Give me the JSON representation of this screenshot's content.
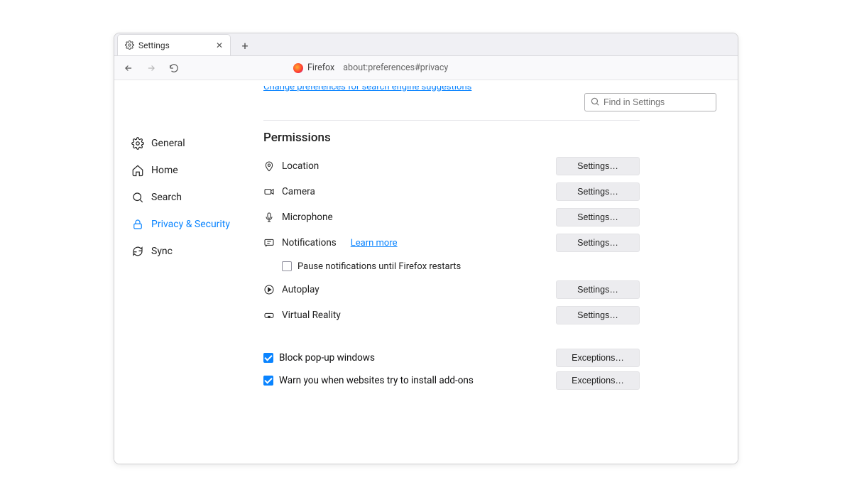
{
  "tab": {
    "title": "Settings"
  },
  "urlbar": {
    "product": "Firefox",
    "url": "about:preferences#privacy"
  },
  "search": {
    "placeholder": "Find in Settings"
  },
  "sidebar": {
    "items": [
      {
        "label": "General"
      },
      {
        "label": "Home"
      },
      {
        "label": "Search"
      },
      {
        "label": "Privacy & Security"
      },
      {
        "label": "Sync"
      }
    ]
  },
  "main": {
    "linkCut": "Change preferences for search engine suggestions",
    "sectionTitle": "Permissions",
    "perms": {
      "location": {
        "label": "Location",
        "btn": "Settings…"
      },
      "camera": {
        "label": "Camera",
        "btn": "Settings…"
      },
      "microphone": {
        "label": "Microphone",
        "btn": "Settings…"
      },
      "notifications": {
        "label": "Notifications",
        "learn": "Learn more",
        "btn": "Settings…",
        "pause": "Pause notifications until Firefox restarts"
      },
      "autoplay": {
        "label": "Autoplay",
        "btn": "Settings…"
      },
      "vr": {
        "label": "Virtual Reality",
        "btn": "Settings…"
      }
    },
    "checks": {
      "popups": {
        "label": "Block pop-up windows",
        "btn": "Exceptions…"
      },
      "addons": {
        "label": "Warn you when websites try to install add-ons",
        "btn": "Exceptions…"
      }
    }
  }
}
